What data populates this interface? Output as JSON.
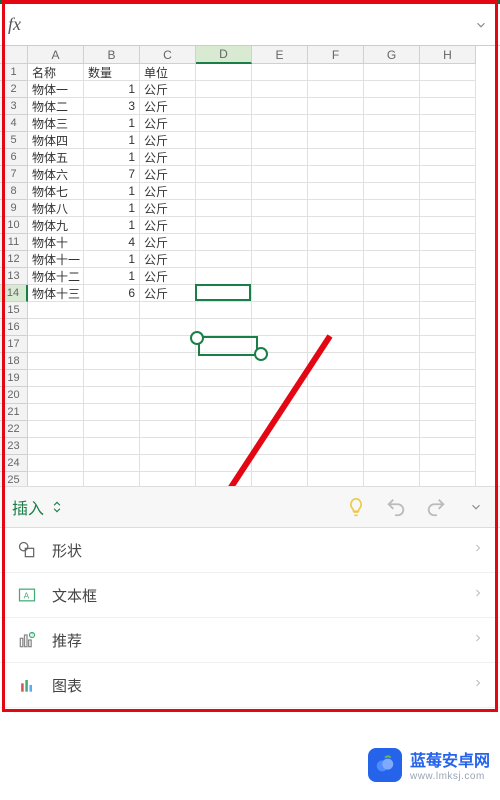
{
  "colors": {
    "accent": "#1a7f47",
    "annotation": "#e30613",
    "watermark": "#2563eb"
  },
  "fx": {
    "label": "fx",
    "value": ""
  },
  "sheet": {
    "columns": [
      "A",
      "B",
      "C",
      "D",
      "E",
      "F",
      "G",
      "H"
    ],
    "selected_col_index": 3,
    "selected_row": 14,
    "headers": {
      "A": "名称",
      "B": "数量",
      "C": "单位"
    },
    "rows": [
      {
        "A": "物体一",
        "B": 1,
        "C": "公斤"
      },
      {
        "A": "物体二",
        "B": 3,
        "C": "公斤"
      },
      {
        "A": "物体三",
        "B": 1,
        "C": "公斤"
      },
      {
        "A": "物体四",
        "B": 1,
        "C": "公斤"
      },
      {
        "A": "物体五",
        "B": 1,
        "C": "公斤"
      },
      {
        "A": "物体六",
        "B": 7,
        "C": "公斤"
      },
      {
        "A": "物体七",
        "B": 1,
        "C": "公斤"
      },
      {
        "A": "物体八",
        "B": 1,
        "C": "公斤"
      },
      {
        "A": "物体九",
        "B": 1,
        "C": "公斤"
      },
      {
        "A": "物体十",
        "B": 4,
        "C": "公斤"
      },
      {
        "A": "物体十一",
        "B": 1,
        "C": "公斤"
      },
      {
        "A": "物体十二",
        "B": 1,
        "C": "公斤"
      },
      {
        "A": "物体十三",
        "B": 6,
        "C": "公斤"
      }
    ],
    "visible_row_count": 26
  },
  "toolbar": {
    "insert_label": "插入"
  },
  "menu": [
    {
      "icon": "shapes-icon",
      "label": "形状"
    },
    {
      "icon": "textbox-icon",
      "label": "文本框"
    },
    {
      "icon": "recommend-icon",
      "label": "推荐"
    },
    {
      "icon": "chart-icon",
      "label": "图表"
    }
  ],
  "watermark": {
    "text": "蓝莓安卓网",
    "sub": "www.lmksj.com"
  }
}
